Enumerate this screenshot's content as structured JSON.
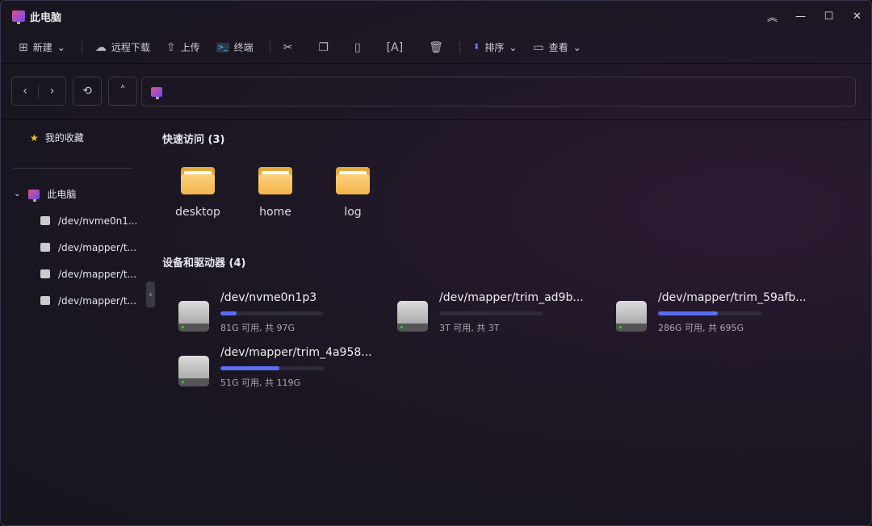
{
  "window": {
    "title": "此电脑",
    "controls": [
      "︽",
      "—",
      "☐",
      "✕"
    ]
  },
  "toolbar": {
    "new": "新建",
    "remote_download": "远程下载",
    "upload": "上传",
    "terminal": "终端",
    "sort": "排序",
    "view": "查看"
  },
  "sidebar": {
    "favorites": "我的收藏",
    "this_pc": "此电脑",
    "drives": [
      "/dev/nvme0n1...",
      "/dev/mapper/t...",
      "/dev/mapper/t...",
      "/dev/mapper/t..."
    ]
  },
  "quick_access": {
    "title": "快速访问 (3)",
    "folders": [
      "desktop",
      "home",
      "log"
    ]
  },
  "devices": {
    "title": "设备和驱动器 (4)",
    "items": [
      {
        "name": "/dev/nvme0n1p3",
        "info": "81G 可用, 共 97G",
        "used": 0.16
      },
      {
        "name": "/dev/mapper/trim_ad9b...",
        "info": "3T 可用, 共 3T",
        "used": 0.0
      },
      {
        "name": "/dev/mapper/trim_59afb...",
        "info": "286G 可用, 共 695G",
        "used": 0.58
      },
      {
        "name": "/dev/mapper/trim_4a958...",
        "info": "51G 可用, 共 119G",
        "used": 0.57
      }
    ]
  },
  "colors": {
    "accent": "#5b6df5",
    "folder": "#f3b54a"
  }
}
